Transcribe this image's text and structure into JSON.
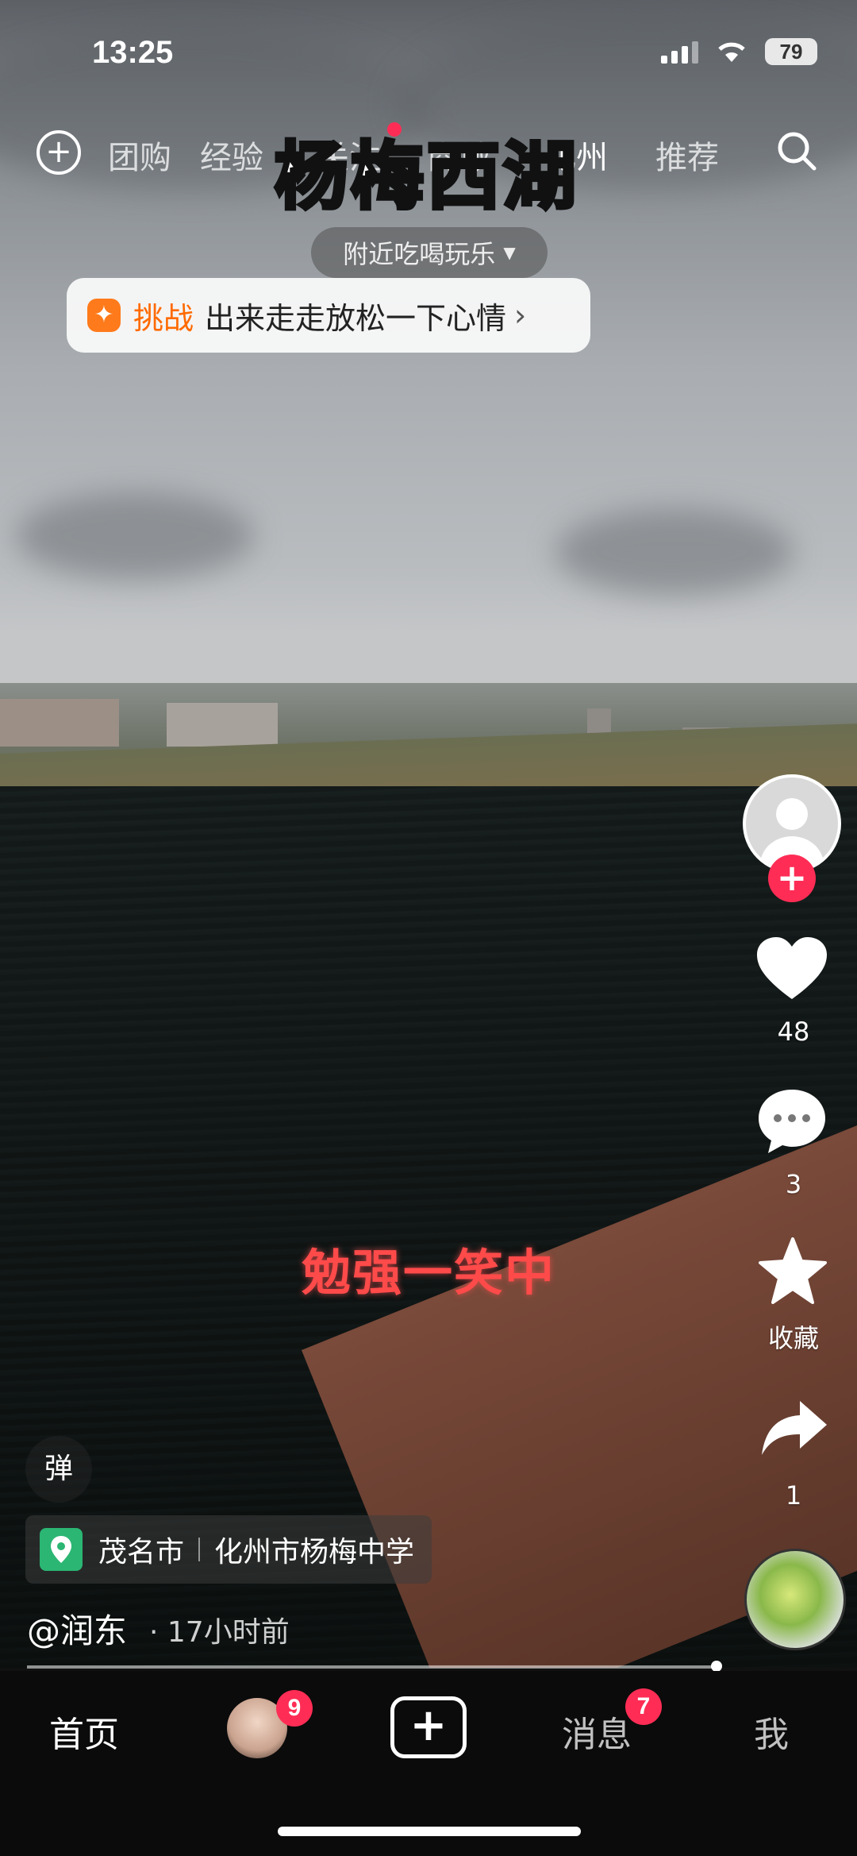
{
  "status": {
    "time": "13:25",
    "battery": "79"
  },
  "topnav": {
    "tabs": [
      "团购",
      "经验",
      "关注",
      "商城",
      "化州",
      "推荐"
    ],
    "overlay_title": "杨梅西湖",
    "nearby": "附近吃喝玩乐"
  },
  "challenge": {
    "label": "挑战",
    "text": "出来走走放松一下心情",
    "arrow": "›"
  },
  "video": {
    "caption": "勉强一笑中",
    "danmu": "弹"
  },
  "actions": {
    "likes": "48",
    "comments": "3",
    "favorite_label": "收藏",
    "shares": "1"
  },
  "location": {
    "city": "茂名市",
    "place": "化州市杨梅中学"
  },
  "post": {
    "author": "@润东",
    "time_ago": "· 17小时前"
  },
  "progress": 0.89,
  "bottom_nav": {
    "home": "首页",
    "friends_badge": "9",
    "messages": "消息",
    "messages_badge": "7",
    "me": "我"
  },
  "icons": [
    "add-circle-icon",
    "search-icon",
    "dropdown-icon",
    "challenge-icon",
    "heart-icon",
    "comment-icon",
    "star-icon",
    "share-icon",
    "location-pin-icon",
    "create-plus-icon"
  ]
}
